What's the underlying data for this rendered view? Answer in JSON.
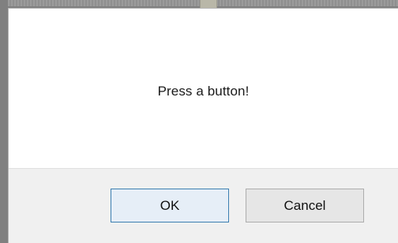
{
  "dialog": {
    "message": "Press a button!"
  },
  "buttons": {
    "ok_label": "OK",
    "cancel_label": "Cancel"
  },
  "colors": {
    "dialog_background": "#ffffff",
    "footer_background": "#f0f0f0",
    "default_button_border": "#3c7fb1",
    "default_button_fill": "#e6eef7",
    "button_border": "#adadad",
    "button_fill": "#e6e6e6",
    "backdrop": "#808080"
  }
}
